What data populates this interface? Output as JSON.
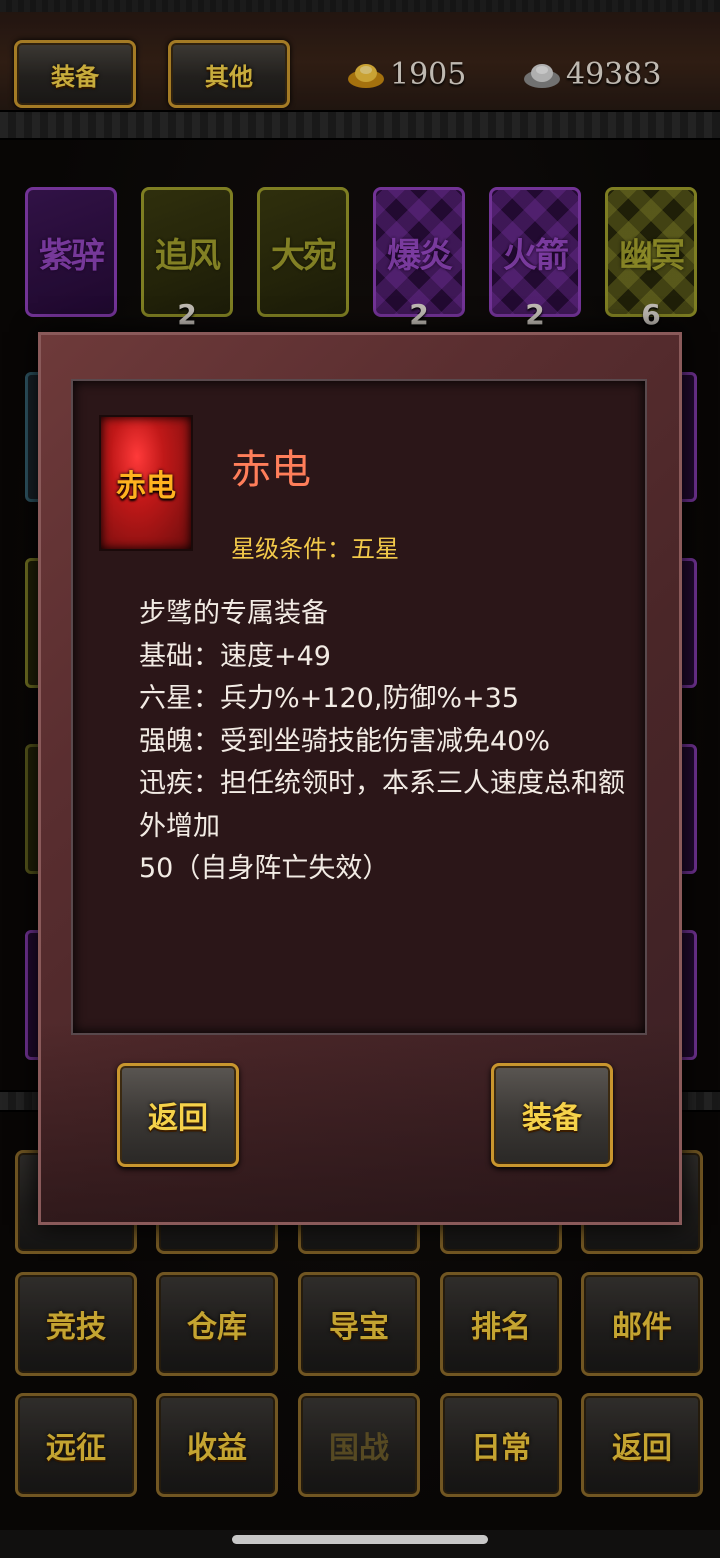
{
  "tabs": {
    "equip": "装备",
    "other": "其他"
  },
  "currency": {
    "gold": {
      "icon": "gold-ingot-icon",
      "value": "1905"
    },
    "silver": {
      "icon": "silver-ingot-icon",
      "value": "49383"
    }
  },
  "grid_row1": [
    {
      "name": "紫骍",
      "style": "purple",
      "count": ""
    },
    {
      "name": "追风",
      "style": "yellow",
      "count": "2"
    },
    {
      "name": "大宛",
      "style": "yellow",
      "count": ""
    },
    {
      "name": "爆炎",
      "style": "purple-diamond",
      "count": "2"
    },
    {
      "name": "火箭",
      "style": "purple-diamond",
      "count": "2"
    },
    {
      "name": "幽冥",
      "style": "yellow-diamond",
      "count": "6"
    }
  ],
  "menu": {
    "row2": [
      "竞技",
      "仓库",
      "导宝",
      "排名",
      "邮件"
    ],
    "row3": [
      "远征",
      "收益",
      "国战",
      "日常",
      "返回"
    ]
  },
  "modal": {
    "icon_label": "赤电",
    "title": "赤电",
    "star_condition": "星级条件：五星",
    "description": [
      "步骘的专属装备",
      "基础：速度+49",
      "六星：兵力%+120,防御%+35",
      "强魄：受到坐骑技能伤害减免40%",
      "迅疾：担任统领时，本系三人速度总和额外增加",
      "50（自身阵亡失效）"
    ],
    "back_label": "返回",
    "equip_label": "装备"
  },
  "colors": {
    "accent_gold": "#f5d24a",
    "title_red": "#ff7e5a",
    "star_yellow": "#f2c94a"
  }
}
